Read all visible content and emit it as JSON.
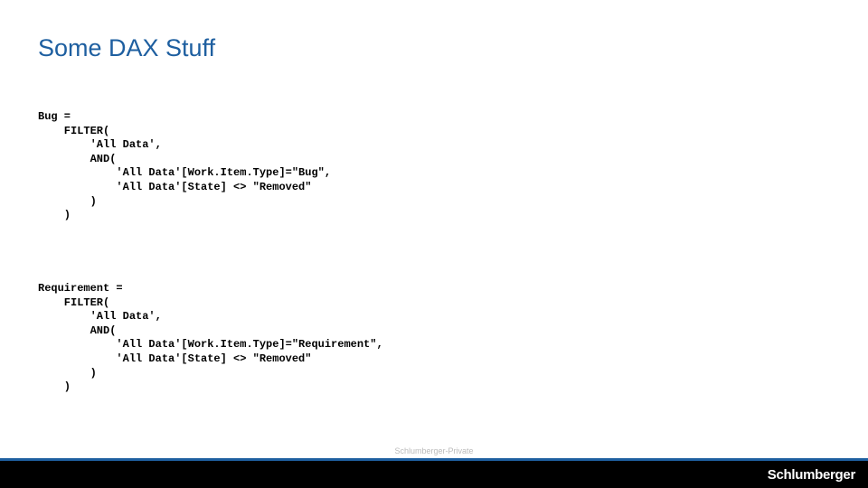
{
  "title": "Some DAX Stuff",
  "code1": "Bug =\n    FILTER(\n        'All Data',\n        AND(\n            'All Data'[Work.Item.Type]=\"Bug\",\n            'All Data'[State] <> \"Removed\"\n        )\n    )",
  "code2": "Requirement =\n    FILTER(\n        'All Data',\n        AND(\n            'All Data'[Work.Item.Type]=\"Requirement\",\n            'All Data'[State] <> \"Removed\"\n        )\n    )",
  "footer_caption": "Schlumberger-Private",
  "footer_logo": "Schlumberger"
}
